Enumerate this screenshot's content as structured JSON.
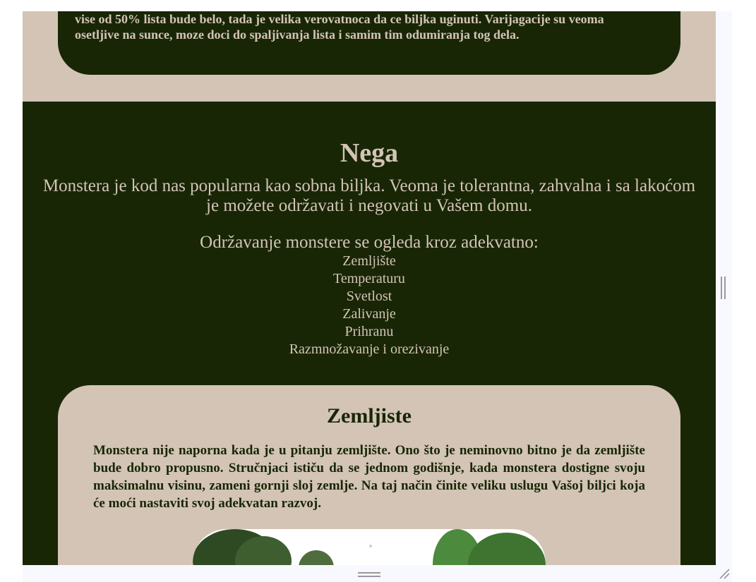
{
  "top_section": {
    "text_line1": "vise od 50% lista bude belo, tada je velika verovatnoca da ce biljka uginuti. Varijagacije su veoma",
    "text_line2": "osetljive na sunce, moze doci do spaljivanja lista i samim tim odumiranja tog dela."
  },
  "care_section": {
    "title": "Nega",
    "intro": "Monstera je kod nas popularna kao sobna biljka. Veoma je tolerantna, zahvalna i sa lakoćom je možete održavati i negovati u Vašem domu.",
    "lead": "Održavanje monstere se ogleda kroz adekvatno:",
    "items": [
      "Zemljište",
      "Temperaturu",
      "Svetlost",
      "Zalivanje",
      "Prihranu",
      "Razmnožavanje i orezivanje"
    ]
  },
  "soil_section": {
    "title": "Zemljiste",
    "text": "Monstera nije naporna kada je u pitanju zemljište. Ono što je neminovno bitno je da zemljište bude dobro propusno. Stručnjaci ističu da se jednom godišnje, kada monstera dostigne svoju maksimalnu visinu, zameni gornji sloj zemlje. Na taj način činite veliku uslugu Vašoj biljci koja će moći nastaviti svoj adekvatan razvoj."
  },
  "colors": {
    "dark_green": "#182605",
    "beige": "#d3c4b6",
    "scrollbar_bg": "#f8f8ff"
  },
  "icons": [
    "monstera-plant-image",
    "scroll-handle-icon",
    "resize-grip-icon"
  ]
}
